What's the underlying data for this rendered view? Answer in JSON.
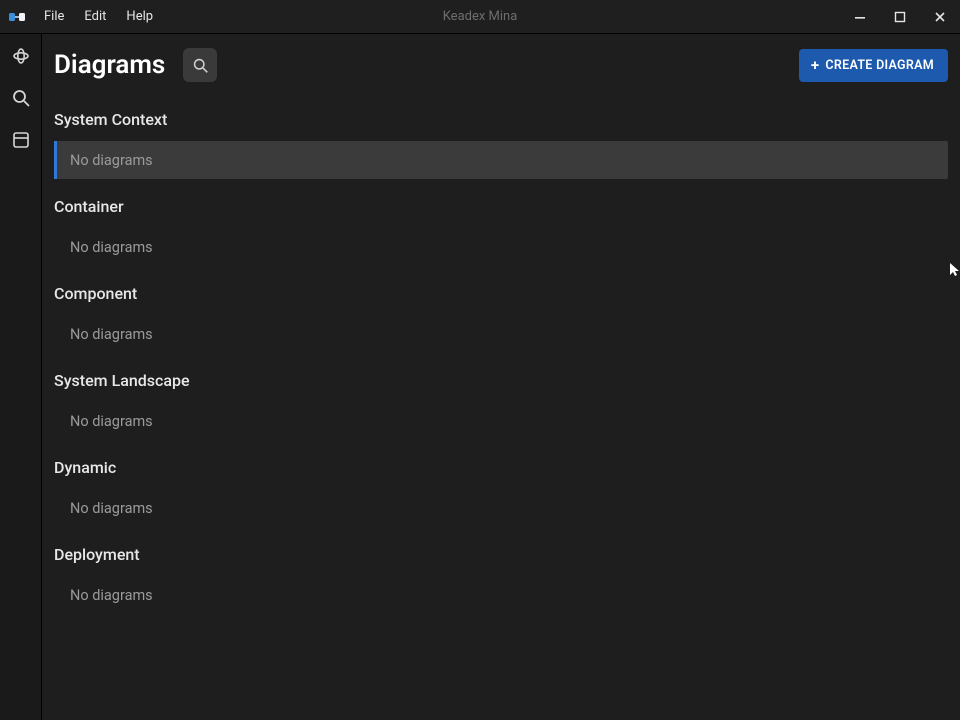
{
  "window": {
    "title": "Keadex Mina",
    "menu": {
      "file": "File",
      "edit": "Edit",
      "help": "Help"
    }
  },
  "sidebar": {
    "items": [
      {
        "name": "diagrams"
      },
      {
        "name": "search"
      },
      {
        "name": "library"
      }
    ]
  },
  "page": {
    "title": "Diagrams",
    "create_button": "CREATE DIAGRAM",
    "categories": [
      {
        "title": "System Context",
        "empty_text": "No diagrams",
        "selected": true
      },
      {
        "title": "Container",
        "empty_text": "No diagrams",
        "selected": false
      },
      {
        "title": "Component",
        "empty_text": "No diagrams",
        "selected": false
      },
      {
        "title": "System Landscape",
        "empty_text": "No diagrams",
        "selected": false
      },
      {
        "title": "Dynamic",
        "empty_text": "No diagrams",
        "selected": false
      },
      {
        "title": "Deployment",
        "empty_text": "No diagrams",
        "selected": false
      }
    ]
  }
}
